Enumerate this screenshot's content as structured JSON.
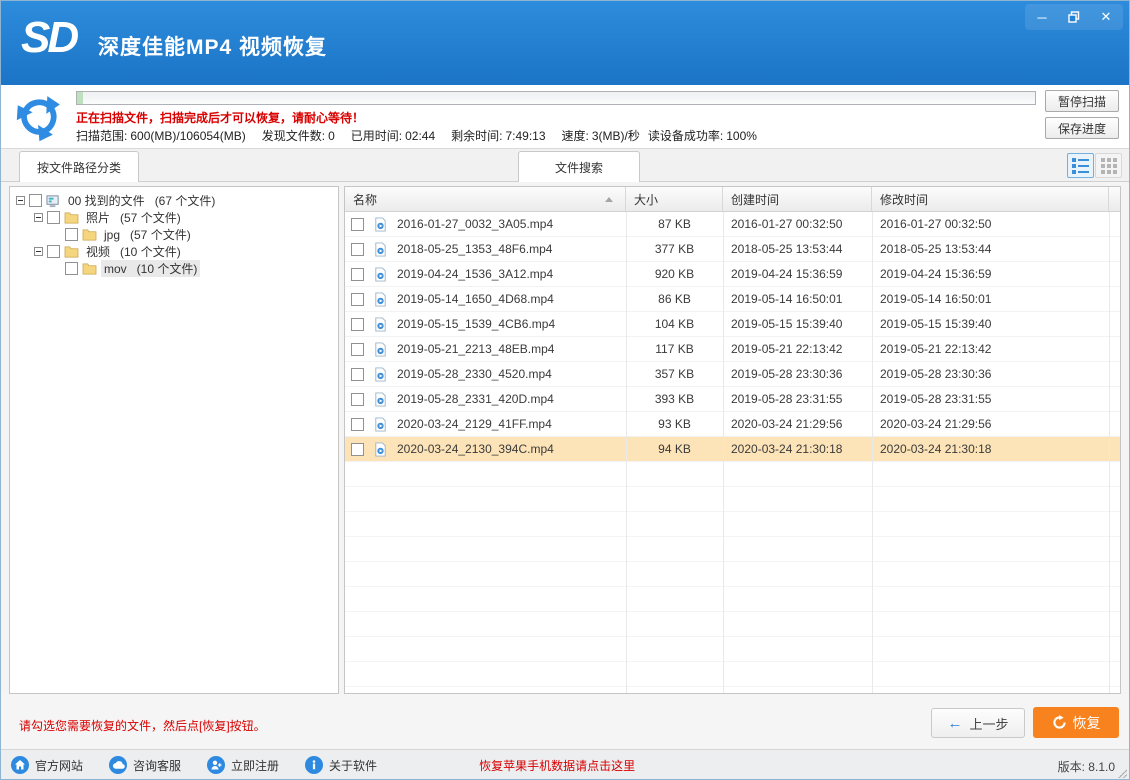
{
  "window": {
    "logo_text": "SD",
    "title": "深度佳能MP4 视频恢复",
    "controls": {
      "minimize": "─",
      "close": "✕"
    }
  },
  "scan": {
    "status": "正在扫描文件，扫描完成后才可以恢复，请耐心等待！",
    "progress_percent": 0.6,
    "stats": [
      {
        "label": "扫描范围:",
        "value": "600(MB)/106054(MB)"
      },
      {
        "label": "发现文件数:",
        "value": "0"
      },
      {
        "label": "已用时间:",
        "value": "02:44"
      },
      {
        "label": "剩余时间:",
        "value": "7:49:13"
      },
      {
        "label": "速度:",
        "value": "3(MB)/秒"
      },
      {
        "label": "读设备成功率:",
        "value": "100%"
      }
    ],
    "pause_label": "暂停扫描",
    "save_label": "保存进度"
  },
  "tabs": {
    "by_path": "按文件路径分类",
    "search": "文件搜索"
  },
  "tree": {
    "items": [
      {
        "label": "00 找到的文件",
        "count": "(67 个文件)"
      },
      {
        "label": "照片",
        "count": "(57 个文件)"
      },
      {
        "label": "jpg",
        "count": "(57 个文件)"
      },
      {
        "label": "视频",
        "count": "(10 个文件)"
      },
      {
        "label": "mov",
        "count": "(10 个文件)"
      }
    ]
  },
  "table": {
    "columns": [
      "名称",
      "大小",
      "创建时间",
      "修改时间"
    ],
    "rows": [
      {
        "name": "2016-01-27_0032_3A05.mp4",
        "size": "87 KB",
        "created": "2016-01-27 00:32:50",
        "modified": "2016-01-27 00:32:50"
      },
      {
        "name": "2018-05-25_1353_48F6.mp4",
        "size": "377 KB",
        "created": "2018-05-25 13:53:44",
        "modified": "2018-05-25 13:53:44"
      },
      {
        "name": "2019-04-24_1536_3A12.mp4",
        "size": "920 KB",
        "created": "2019-04-24 15:36:59",
        "modified": "2019-04-24 15:36:59"
      },
      {
        "name": "2019-05-14_1650_4D68.mp4",
        "size": "86 KB",
        "created": "2019-05-14 16:50:01",
        "modified": "2019-05-14 16:50:01"
      },
      {
        "name": "2019-05-15_1539_4CB6.mp4",
        "size": "104 KB",
        "created": "2019-05-15 15:39:40",
        "modified": "2019-05-15 15:39:40"
      },
      {
        "name": "2019-05-21_2213_48EB.mp4",
        "size": "117 KB",
        "created": "2019-05-21 22:13:42",
        "modified": "2019-05-21 22:13:42"
      },
      {
        "name": "2019-05-28_2330_4520.mp4",
        "size": "357 KB",
        "created": "2019-05-28 23:30:36",
        "modified": "2019-05-28 23:30:36"
      },
      {
        "name": "2019-05-28_2331_420D.mp4",
        "size": "393 KB",
        "created": "2019-05-28 23:31:55",
        "modified": "2019-05-28 23:31:55"
      },
      {
        "name": "2020-03-24_2129_41FF.mp4",
        "size": "93 KB",
        "created": "2020-03-24 21:29:56",
        "modified": "2020-03-24 21:29:56"
      },
      {
        "name": "2020-03-24_2130_394C.mp4",
        "size": "94 KB",
        "created": "2020-03-24 21:30:18",
        "modified": "2020-03-24 21:30:18",
        "selected": true
      }
    ]
  },
  "actions": {
    "hint": "请勾选您需要恢复的文件，然后点[恢复]按钮。",
    "back_label": "上一步",
    "recover_label": "恢复"
  },
  "footer": {
    "links": [
      {
        "label": "官方网站"
      },
      {
        "label": "咨询客服"
      },
      {
        "label": "立即注册"
      },
      {
        "label": "关于软件"
      }
    ],
    "promo": "恢复苹果手机数据请点击这里",
    "version_text": "版本: 8.1.0"
  },
  "colors": {
    "accent_blue": "#2e8ae0",
    "recover_orange": "#f8821e",
    "alert_red": "#d80000",
    "selected_row": "#fce4b8"
  }
}
